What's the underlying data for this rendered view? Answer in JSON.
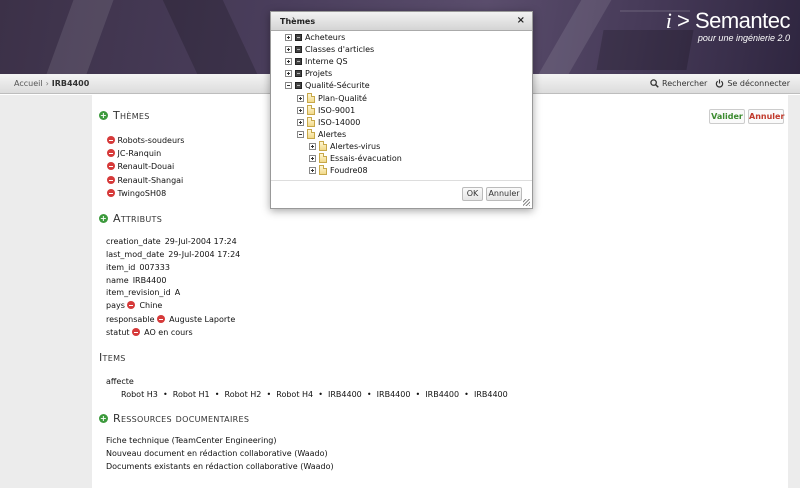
{
  "header": {
    "brand_prefix": "i",
    "brand_name": "> Semantec",
    "tagline": "pour une ingénierie 2.0"
  },
  "breadcrumb": {
    "home": "Accueil",
    "separator": "›",
    "current": "IRB4400"
  },
  "toplinks": {
    "search": "Rechercher",
    "logout": "Se déconnecter"
  },
  "actions": {
    "validate": "Valider",
    "cancel": "Annuler"
  },
  "themes": {
    "title": "Thèmes",
    "items": [
      "Robots-soudeurs",
      "JC-Ranquin",
      "Renault-Douai",
      "Renault-Shangai",
      "TwingoSH08"
    ]
  },
  "attributes": {
    "title": "Attributs",
    "rows": [
      {
        "key": "creation_date",
        "value": "29-Jul-2004 17:24"
      },
      {
        "key": "last_mod_date",
        "value": "29-Jul-2004 17:24"
      },
      {
        "key": "item_id",
        "value": "007333"
      },
      {
        "key": "name",
        "value": "IRB4400"
      },
      {
        "key": "item_revision_id",
        "value": "A"
      },
      {
        "key": "pays",
        "value": "Chine"
      },
      {
        "key": "responsable",
        "value": "Auguste Laporte"
      },
      {
        "key": "statut",
        "value": "AO en cours"
      }
    ]
  },
  "items": {
    "title": "Items",
    "label": "affecte",
    "values": [
      "Robot H3",
      "Robot H1",
      "Robot H2",
      "Robot H4",
      "IRB4400",
      "IRB4400",
      "IRB4400",
      "IRB4400"
    ]
  },
  "resources": {
    "title": "Ressources documentaires",
    "items": [
      "Fiche technique (TeamCenter Engineering)",
      "Nouveau document en rédaction collaborative (Waado)",
      "Documents existants en rédaction collaborative (Waado)"
    ]
  },
  "dialog": {
    "title": "Thèmes",
    "close": "×",
    "tree": [
      {
        "label": "Acheteurs"
      },
      {
        "label": "Classes d'articles"
      },
      {
        "label": "Interne QS"
      },
      {
        "label": "Projets"
      },
      {
        "label": "Qualité-Sécurite"
      },
      {
        "label": "Plan-Qualité"
      },
      {
        "label": "ISO-9001"
      },
      {
        "label": "ISO-14000"
      },
      {
        "label": "Alertes"
      },
      {
        "label": "Alertes-virus"
      },
      {
        "label": "Essais-évacuation"
      },
      {
        "label": "Foudre08"
      }
    ],
    "ok": "OK",
    "cancel": "Annuler"
  },
  "colors": {
    "accent_green": "#3d9a3d",
    "accent_red": "#d63a3a",
    "header_bg": "#4a3e5c"
  }
}
